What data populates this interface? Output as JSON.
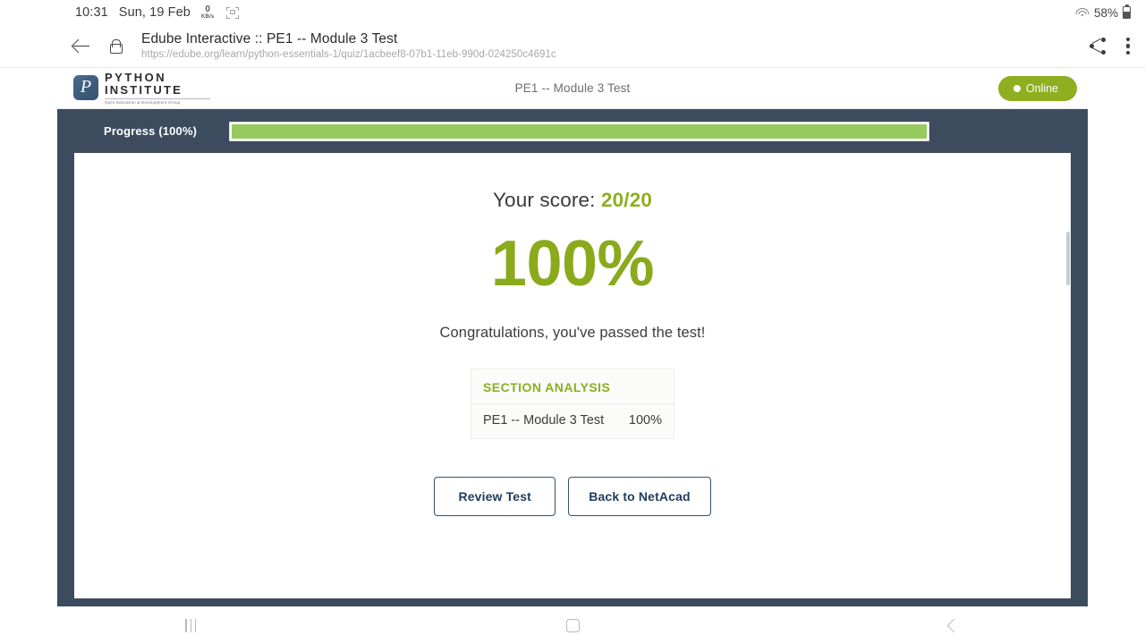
{
  "status_bar": {
    "time": "10:31",
    "date": "Sun, 19 Feb",
    "network_rate": "0",
    "network_unit": "KB/s",
    "battery_percent": "58%",
    "icons": [
      "screen-capture-icon",
      "wifi-icon",
      "battery-icon"
    ]
  },
  "browser": {
    "page_title": "Edube Interactive :: PE1 -- Module 3 Test",
    "url": "https://edube.org/learn/python-essentials-1/quiz/1acbeef8-07b1-11eb-990d-024250c4691c",
    "icons": [
      "back-arrow-icon",
      "lock-icon",
      "share-icon",
      "overflow-menu-icon"
    ]
  },
  "site_header": {
    "logo_line1": "PYTHON",
    "logo_line2": "INSTITUTE",
    "logo_tagline": "Open Education & Development Group",
    "logo_mark_letter": "P",
    "title": "PE1 -- Module 3 Test",
    "online_label": "Online",
    "online_color": "#8fae20"
  },
  "progress": {
    "label": "Progress (100%)",
    "percent": 100,
    "fill_color": "#96ca5e"
  },
  "result": {
    "score_prefix": "Your score:",
    "score_value": "20/20",
    "percent_big": "100%",
    "congrats": "Congratulations, you've passed the test!",
    "accent_color": "#8fae20"
  },
  "section_analysis": {
    "heading": "SECTION ANALYSIS",
    "rows": [
      {
        "name": "PE1 -- Module 3 Test",
        "score": "100%"
      }
    ]
  },
  "buttons": {
    "review": "Review Test",
    "back": "Back to NetAcad"
  },
  "nav_bar": {
    "recents": "recents-icon",
    "home": "home-icon",
    "back": "back-icon"
  }
}
